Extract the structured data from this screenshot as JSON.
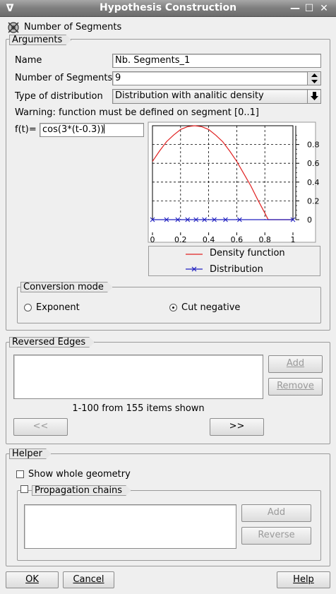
{
  "window": {
    "title": "Hypothesis Construction"
  },
  "header": {
    "label": "Number of Segments",
    "icon": "hypothesis-icon"
  },
  "arguments": {
    "group_label": "Arguments",
    "name_label": "Name",
    "name_value": "Nb. Segments_1",
    "segments_label": "Number of Segments",
    "segments_value": "9",
    "distribution_label": "Type of distribution",
    "distribution_value": "Distribution with analitic density",
    "warning": "Warning: function must be defined on segment [0..1]",
    "ft_label": "f(t)=",
    "ft_value": "cos(3*(t-0.3))"
  },
  "chart_data": {
    "type": "line",
    "x_ticks": [
      "0",
      "0.2",
      "0.4",
      "0.6",
      "0.8",
      "1"
    ],
    "y_ticks": [
      "0",
      "0.2",
      "0.4",
      "0.6",
      "0.8"
    ],
    "xlim": [
      0,
      1
    ],
    "ylim": [
      0,
      1
    ],
    "grid": true,
    "legend_placement": "bottom",
    "series": [
      {
        "name": "Density function",
        "color": "#e02020",
        "x": [
          0,
          0.05,
          0.1,
          0.15,
          0.2,
          0.25,
          0.3,
          0.35,
          0.4,
          0.45,
          0.5,
          0.55,
          0.6,
          0.65,
          0.7,
          0.75,
          0.8,
          0.824,
          1.0
        ],
        "y": [
          0.62,
          0.73,
          0.83,
          0.9,
          0.96,
          0.99,
          1.0,
          0.99,
          0.96,
          0.9,
          0.83,
          0.73,
          0.62,
          0.49,
          0.36,
          0.21,
          0.07,
          0.0,
          0.0
        ]
      },
      {
        "name": "Distribution",
        "color": "#2020c0",
        "x": [
          0,
          0.1,
          0.18,
          0.25,
          0.31,
          0.37,
          0.44,
          0.52,
          0.62,
          1.0
        ],
        "y": [
          0,
          0,
          0,
          0,
          0,
          0,
          0,
          0,
          0,
          0
        ]
      }
    ]
  },
  "conversion": {
    "group_label": "Conversion mode",
    "exponent_label": "Exponent",
    "cut_label": "Cut negative",
    "selected": "Cut negative"
  },
  "reversed": {
    "group_label": "Reversed Edges",
    "add_label": "Add",
    "remove_label": "Remove",
    "status": "1-100 from 155 items shown",
    "prev_label": "<<",
    "next_label": ">>"
  },
  "helper": {
    "group_label": "Helper",
    "show_geometry_label": "Show whole geometry",
    "chains_label": "Propagation chains",
    "add_label": "Add",
    "reverse_label": "Reverse"
  },
  "footer": {
    "ok_label": "OK",
    "cancel_label": "Cancel",
    "help_label": "Help"
  }
}
